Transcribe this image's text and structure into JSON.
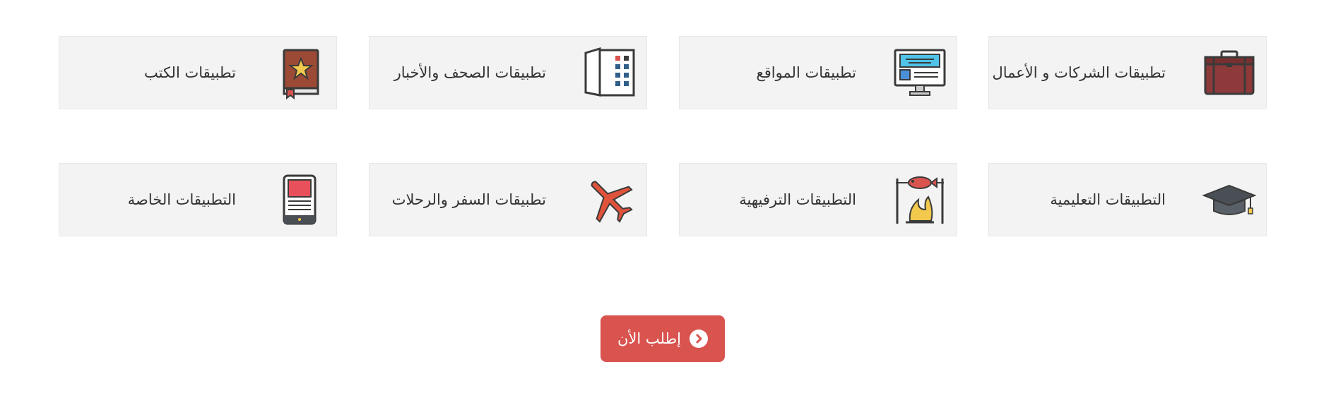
{
  "categories": [
    {
      "label": "تطبيقات الشركات و الأعمال",
      "icon": "briefcase-icon"
    },
    {
      "label": "تطبيقات المواقع",
      "icon": "monitor-icon"
    },
    {
      "label": "تطبيقات الصحف والأخبار",
      "icon": "newspaper-icon"
    },
    {
      "label": "تطبيقات الكتب",
      "icon": "book-icon"
    },
    {
      "label": "التطبيقات التعليمية",
      "icon": "graduation-cap-icon"
    },
    {
      "label": "التطبيقات الترفيهية",
      "icon": "campfire-fish-icon"
    },
    {
      "label": "تطبيقات السفر والرحلات",
      "icon": "airplane-icon"
    },
    {
      "label": "التطبيقات الخاصة",
      "icon": "tablet-icon"
    }
  ],
  "cta": {
    "label": "إطلب الأن",
    "icon": "chevron-circle-right-icon",
    "color": "#d9534f"
  },
  "colors": {
    "card_bg": "#f3f3f3",
    "text": "#333333",
    "accent": "#d9534f"
  }
}
